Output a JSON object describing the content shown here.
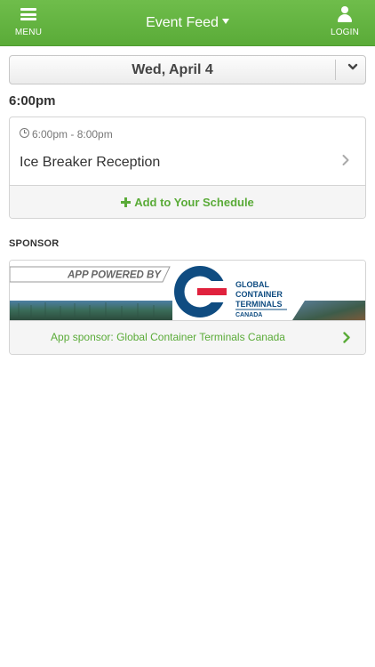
{
  "nav": {
    "menu_label": "MENU",
    "title": "Event Feed",
    "login_label": "LOGIN"
  },
  "date_selector": {
    "value": "Wed, April 4"
  },
  "schedule": {
    "time_heading": "6:00pm",
    "events": [
      {
        "time_range": "6:00pm - 8:00pm",
        "title": "Ice Breaker Reception",
        "add_label": "Add to Your Schedule"
      }
    ]
  },
  "sponsor": {
    "heading": "SPONSOR",
    "banner_tagline": "APP POWERED BY",
    "logo_lines": [
      "GLOBAL",
      "CONTAINER",
      "TERMINALS",
      "CANADA"
    ],
    "link_text": "App sponsor: Global Container Terminals Canada"
  },
  "colors": {
    "brand_green": "#5aab38",
    "logo_blue": "#0f4c81",
    "logo_red": "#e0213d"
  },
  "icons": {
    "menu": "hamburger-icon",
    "title_caret": "caret-down-icon",
    "login": "user-icon",
    "date_toggle": "chevron-down-icon",
    "event_time": "clock-icon",
    "event_open": "chevron-right-icon",
    "add": "plus-icon",
    "sponsor_open": "chevron-right-icon"
  }
}
